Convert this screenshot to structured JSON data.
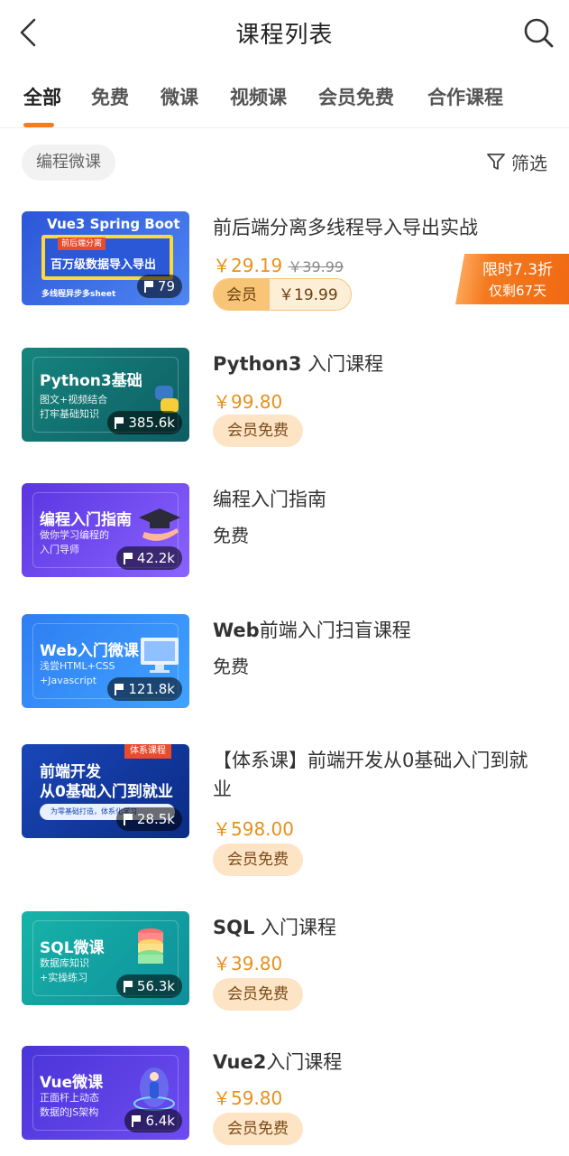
{
  "header": {
    "title": "课程列表",
    "back_icon": "back-icon",
    "search_icon": "search-icon"
  },
  "tabs": [
    {
      "label": "全部",
      "active": true
    },
    {
      "label": "免费"
    },
    {
      "label": "微课"
    },
    {
      "label": "视频课"
    },
    {
      "label": "会员免费"
    },
    {
      "label": "合作课程"
    }
  ],
  "filter_bar": {
    "chip": "编程微课",
    "filter_label": "筛选",
    "filter_icon": "funnel-icon"
  },
  "courses": [
    {
      "thumb_title": "Vue3 Spring Boot",
      "thumb_banner": "百万级数据导入导出",
      "thumb_tag": "前后端分离",
      "thumb_footer": "多线程异步多sheet",
      "count": "79",
      "title": "前后端分离多线程导入导出实战",
      "price": "￥29.19",
      "original_price": "￥39.99",
      "member_label": "会员",
      "member_price": "￥19.99",
      "promo_line1": "限时7.3折",
      "promo_line2": "仅剩67天"
    },
    {
      "thumb_title": "Python3基础",
      "thumb_sub": "图文+视频结合\n打牢基础知识",
      "count": "385.6k",
      "title_bold": "Python3",
      "title_rest": " 入门课程",
      "price": "￥99.80",
      "member": "会员免费"
    },
    {
      "thumb_title": "编程入门指南",
      "thumb_sub": "做你学习编程的\n入门导师",
      "count": "42.2k",
      "title": "编程入门指南",
      "free": "免费"
    },
    {
      "thumb_title": "Web入门微课",
      "thumb_sub": "浅尝HTML+CSS\n+Javascript",
      "count": "121.8k",
      "title_bold": "Web",
      "title_rest": "前端入门扫盲课程",
      "free": "免费"
    },
    {
      "thumb_title": "前端开发\n从0基础入门到就业",
      "thumb_tag": "体系课程",
      "thumb_footer": "为零基础打造，体系化学习",
      "count": "28.5k",
      "title": "【体系课】前端开发从0基础入门到就业",
      "price": "￥598.00",
      "member": "会员免费"
    },
    {
      "thumb_title": "SQL微课",
      "thumb_sub": "数据库知识\n+实操练习",
      "count": "56.3k",
      "title_bold": "SQL",
      "title_rest": " 入门课程",
      "price": "￥39.80",
      "member": "会员免费"
    },
    {
      "thumb_title": "Vue微课",
      "thumb_sub": "正面杆上动态\n数据的JS架构",
      "count": "6.4k",
      "title_bold": "Vue2",
      "title_rest": "入门课程",
      "price": "￥59.80",
      "member": "会员免费"
    }
  ],
  "colors": {
    "accent": "#f57c1f",
    "price": "#e8901c",
    "member_bg": "#fde4c5"
  }
}
